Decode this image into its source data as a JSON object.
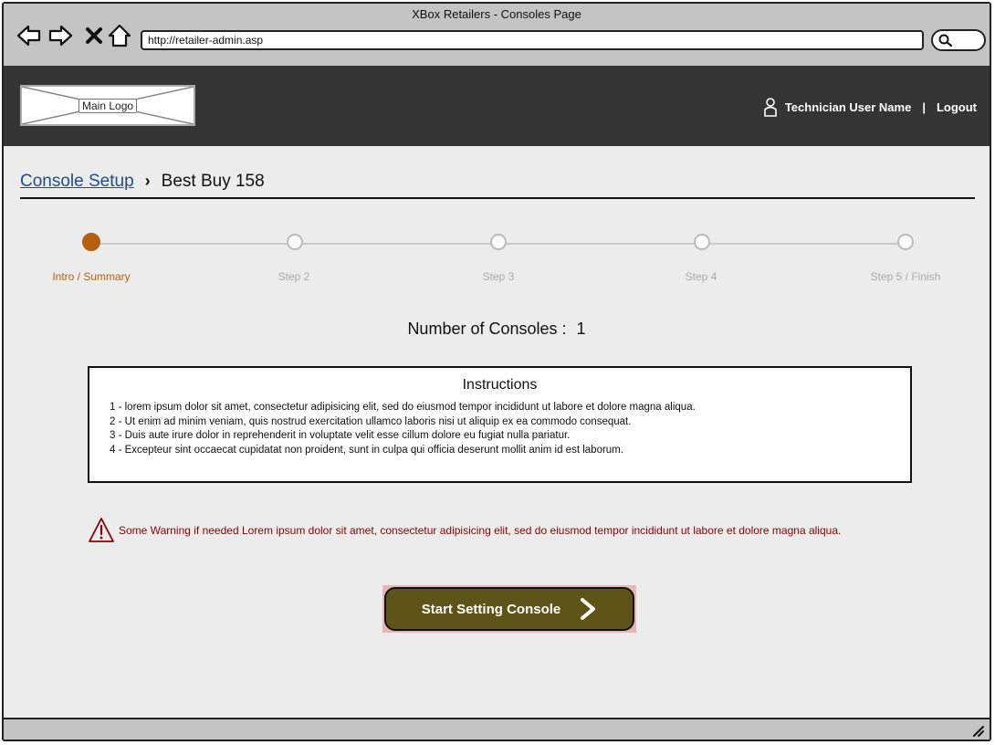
{
  "window": {
    "title": "XBox Retailers - Consoles Page",
    "url": "http://retailer-admin.asp"
  },
  "header": {
    "logo_label": "Main Logo",
    "user_name": "Technician User Name",
    "separator": "|",
    "logout_label": "Logout"
  },
  "breadcrumb": {
    "link_label": "Console Setup",
    "separator": "›",
    "current": "Best Buy 158"
  },
  "stepper": {
    "active_index": 0,
    "steps": [
      {
        "label": "Intro / Summary"
      },
      {
        "label": "Step 2"
      },
      {
        "label": "Step 3"
      },
      {
        "label": "Step 4"
      },
      {
        "label": "Step 5 / Finish"
      }
    ]
  },
  "consoles": {
    "label": "Number of Consoles :",
    "value": "1"
  },
  "instructions": {
    "title": "Instructions",
    "items": [
      "1 - lorem ipsum dolor sit amet, consectetur adipisicing elit, sed do eiusmod tempor incididunt ut labore et dolore magna aliqua.",
      "2 - Ut enim ad minim veniam, quis nostrud exercitation ullamco laboris nisi ut aliquip ex ea commodo consequat.",
      "3 - Duis aute irure dolor in reprehenderit in voluptate velit esse cillum dolore eu fugiat nulla pariatur.",
      "4 - Excepteur sint occaecat cupidatat non proident, sunt in culpa qui officia deserunt mollit anim id est laborum."
    ]
  },
  "warning": {
    "text": "Some Warning if needed Lorem ipsum dolor sit amet, consectetur adipisicing elit, sed do eiusmod tempor incididunt ut labore et dolore magna aliqua."
  },
  "cta": {
    "label": "Start Setting Console"
  },
  "colors": {
    "accent": "#b5600f",
    "header_bg": "#343434",
    "cta_bg": "#5f5418",
    "warning": "#8b0000",
    "link": "#1f4e8c"
  }
}
